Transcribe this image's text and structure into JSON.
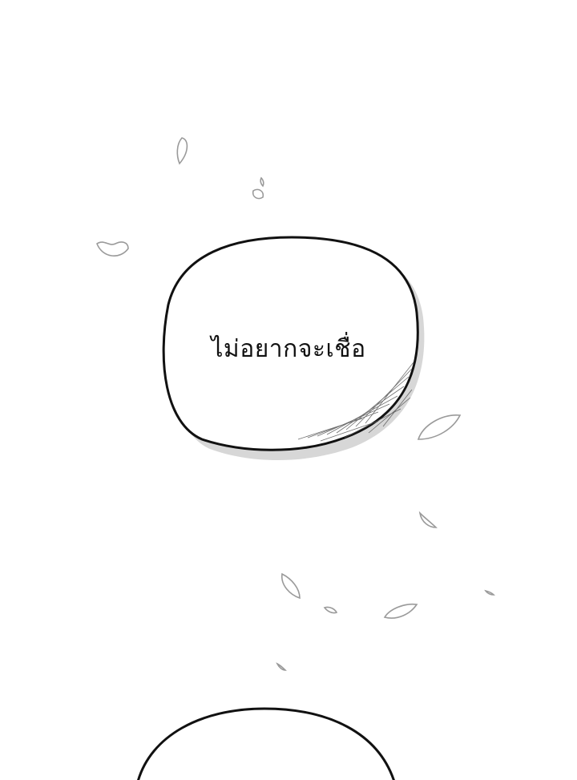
{
  "panel": {
    "background_color": "#ffffff",
    "ink_color": "#111111",
    "petal_color": "#9a9a9a",
    "shadow_color": "#c9c9c9"
  },
  "speech_bubble": {
    "text": "ไม่อยากจะเชื่อ"
  }
}
